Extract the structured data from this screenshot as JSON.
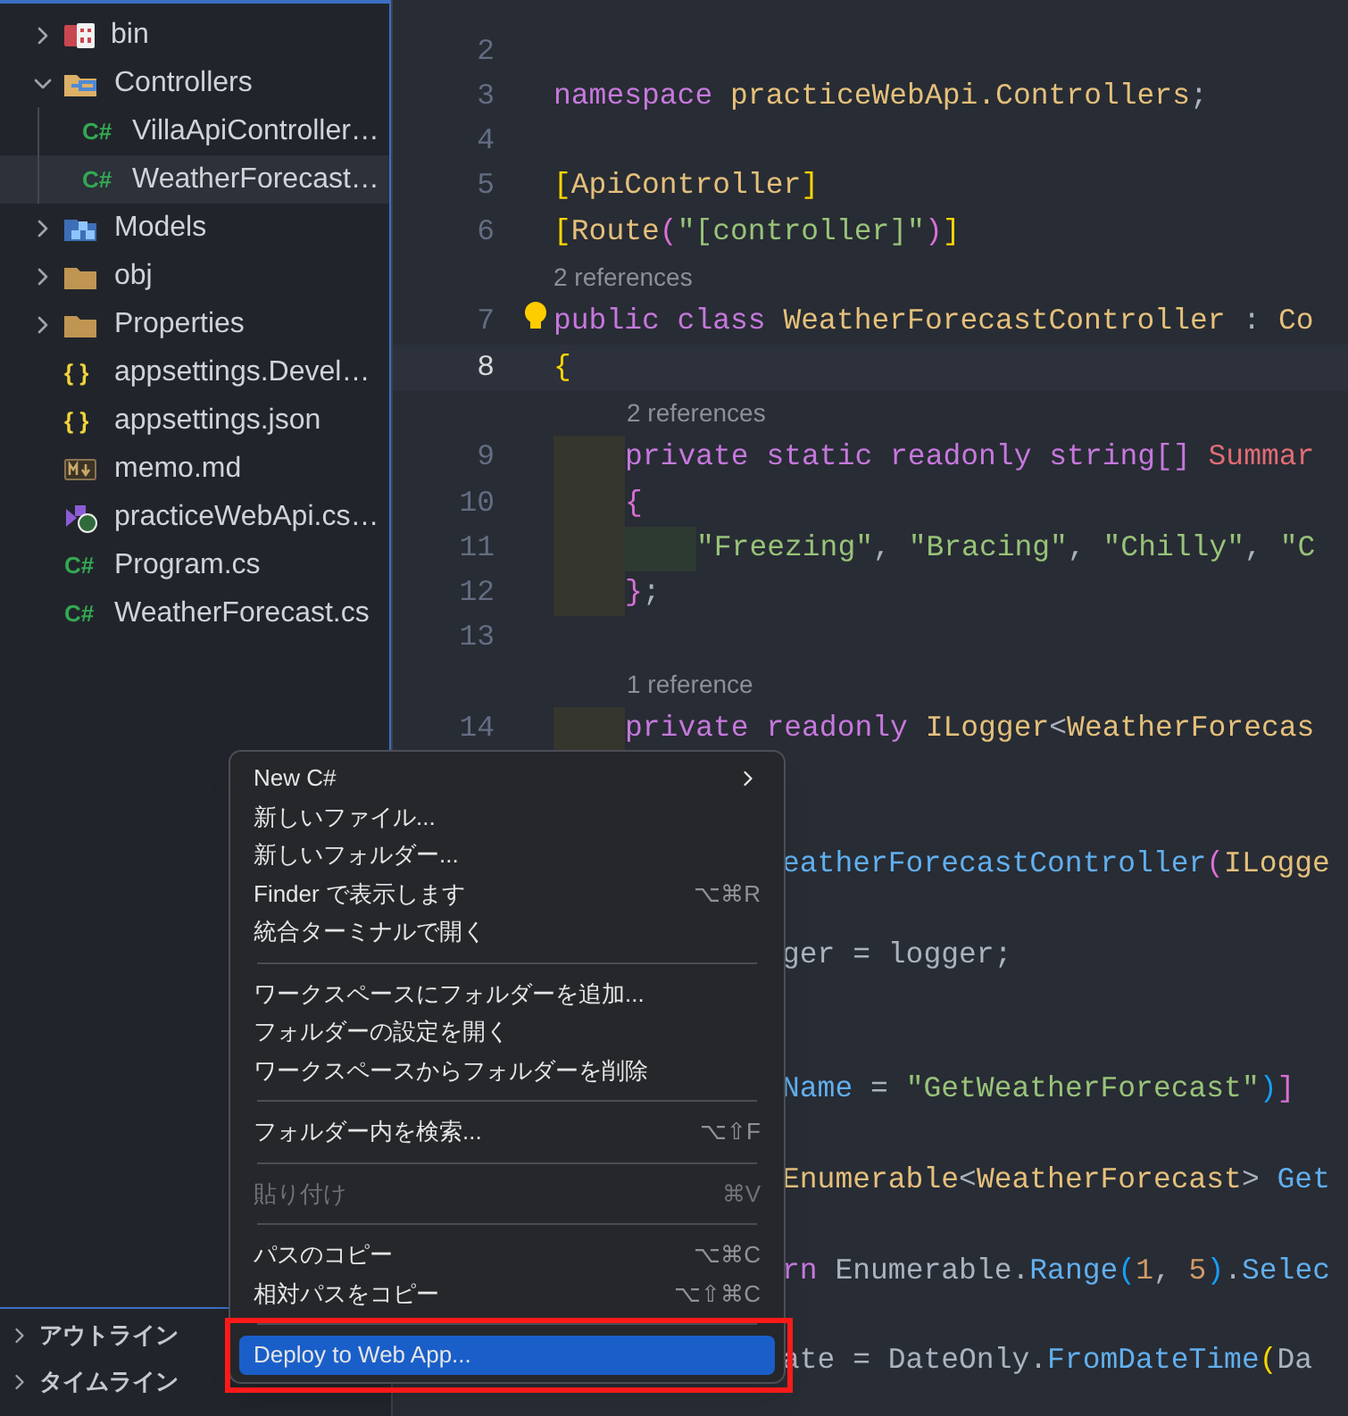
{
  "explorer": {
    "items": [
      {
        "name": "bin",
        "kind": "folder-bin",
        "expanded": false,
        "selected": false
      },
      {
        "name": "Controllers",
        "kind": "folder-controllers",
        "expanded": true,
        "selected": false,
        "children": [
          {
            "name": "VillaApiController…",
            "kind": "csharp",
            "icon_label": "C#",
            "selected": false
          },
          {
            "name": "WeatherForecast…",
            "kind": "csharp",
            "icon_label": "C#",
            "selected": true
          }
        ]
      },
      {
        "name": "Models",
        "kind": "folder-models",
        "expanded": false,
        "selected": false
      },
      {
        "name": "obj",
        "kind": "folder",
        "expanded": false,
        "selected": false
      },
      {
        "name": "Properties",
        "kind": "folder",
        "expanded": false,
        "selected": false
      },
      {
        "name": "appsettings.Devel…",
        "kind": "json",
        "icon_label": "{ }",
        "selected": false
      },
      {
        "name": "appsettings.json",
        "kind": "json",
        "icon_label": "{ }",
        "selected": false
      },
      {
        "name": "memo.md",
        "kind": "markdown",
        "selected": false
      },
      {
        "name": "practiceWebApi.cs…",
        "kind": "csproj",
        "selected": false
      },
      {
        "name": "Program.cs",
        "kind": "csharp",
        "icon_label": "C#",
        "selected": false
      },
      {
        "name": "WeatherForecast.cs",
        "kind": "csharp",
        "icon_label": "C#",
        "selected": false
      }
    ]
  },
  "panels": [
    {
      "title": "アウトライン",
      "expanded": false
    },
    {
      "title": "タイムライン",
      "expanded": false
    }
  ],
  "editor": {
    "rows": [
      {
        "kind": "covered"
      },
      {
        "kind": "code",
        "number": "2",
        "current": false
      },
      {
        "kind": "code",
        "number": "3",
        "current": false,
        "tokens": [
          {
            "kind": "kw",
            "text": "namespace "
          },
          {
            "kind": "type",
            "text": "practiceWebApi.Controllers"
          },
          {
            "kind": "plain",
            "text": ";"
          }
        ]
      },
      {
        "kind": "code",
        "number": "4",
        "current": false
      },
      {
        "kind": "code",
        "number": "5",
        "current": false,
        "tokens": [
          {
            "kind": "b1",
            "text": "["
          },
          {
            "kind": "type",
            "text": "ApiController"
          },
          {
            "kind": "b1",
            "text": "]"
          }
        ]
      },
      {
        "kind": "code",
        "number": "6",
        "current": false,
        "tokens": [
          {
            "kind": "b1",
            "text": "["
          },
          {
            "kind": "type",
            "text": "Route"
          },
          {
            "kind": "b2",
            "text": "("
          },
          {
            "kind": "str",
            "text": "\"[controller]\""
          },
          {
            "kind": "b2",
            "text": ")"
          },
          {
            "kind": "b1",
            "text": "]"
          }
        ]
      },
      {
        "kind": "lens",
        "text": "2 references"
      },
      {
        "kind": "code",
        "number": "7",
        "current": false,
        "lightbulb": true,
        "tokens": [
          {
            "kind": "kw",
            "text": "public class "
          },
          {
            "kind": "type",
            "text": "WeatherForecastController"
          },
          {
            "kind": "plain",
            "text": " : "
          },
          {
            "kind": "type",
            "text": "Co"
          }
        ]
      },
      {
        "kind": "code",
        "number": "8",
        "current": true,
        "tokens": [
          {
            "kind": "b1",
            "text": "{"
          }
        ]
      },
      {
        "kind": "nested_lens",
        "text": "2 references"
      },
      {
        "kind": "code",
        "number": "9",
        "current": false,
        "tokens": [
          {
            "kind": "indent1"
          },
          {
            "kind": "kw",
            "text": "private static readonly string[] "
          },
          {
            "kind": "field",
            "text": "Summar"
          }
        ]
      },
      {
        "kind": "code",
        "number": "10",
        "current": false,
        "tokens": [
          {
            "kind": "indent1"
          },
          {
            "kind": "b2",
            "text": "{"
          }
        ]
      },
      {
        "kind": "code",
        "number": "11",
        "current": false,
        "tokens": [
          {
            "kind": "indent1"
          },
          {
            "kind": "indent2"
          },
          {
            "kind": "str",
            "text": "\"Freezing\""
          },
          {
            "kind": "plain",
            "text": ", "
          },
          {
            "kind": "str",
            "text": "\"Bracing\""
          },
          {
            "kind": "plain",
            "text": ", "
          },
          {
            "kind": "str",
            "text": "\"Chilly\""
          },
          {
            "kind": "plain",
            "text": ", "
          },
          {
            "kind": "str",
            "text": "\"C"
          }
        ]
      },
      {
        "kind": "code",
        "number": "12",
        "current": false,
        "tokens": [
          {
            "kind": "indent1"
          },
          {
            "kind": "b2",
            "text": "}"
          },
          {
            "kind": "plain",
            "text": ";"
          }
        ]
      },
      {
        "kind": "code",
        "number": "13",
        "current": false
      },
      {
        "kind": "nested_lens",
        "text": "1 reference"
      },
      {
        "kind": "code",
        "number": "14",
        "current": false,
        "tokens": [
          {
            "kind": "indent1"
          },
          {
            "kind": "kw",
            "text": "private readonly "
          },
          {
            "kind": "type",
            "text": "ILogger"
          },
          {
            "kind": "plain",
            "text": "<"
          },
          {
            "kind": "type",
            "text": "WeatherForecas"
          }
        ]
      },
      {
        "kind": "covered"
      },
      {
        "kind": "covered"
      },
      {
        "kind": "partial",
        "tokens": [
          {
            "kind": "fn",
            "text": "eatherForecastController"
          },
          {
            "kind": "b2",
            "text": "("
          },
          {
            "kind": "type",
            "text": "ILogge"
          }
        ]
      },
      {
        "kind": "covered"
      },
      {
        "kind": "partial",
        "tokens": [
          {
            "kind": "plain",
            "text": "ger = logger;"
          }
        ]
      },
      {
        "kind": "covered"
      },
      {
        "kind": "covered"
      },
      {
        "kind": "partial",
        "tokens": [
          {
            "kind": "fn",
            "text": "Name"
          },
          {
            "kind": "plain",
            "text": " = "
          },
          {
            "kind": "str",
            "text": "\"GetWeatherForecast\""
          },
          {
            "kind": "b3",
            "text": ")"
          },
          {
            "kind": "b2",
            "text": "]"
          }
        ]
      },
      {
        "kind": "covered"
      },
      {
        "kind": "partial",
        "tokens": [
          {
            "kind": "type",
            "text": "Enumerable"
          },
          {
            "kind": "plain",
            "text": "<"
          },
          {
            "kind": "type",
            "text": "WeatherForecast"
          },
          {
            "kind": "plain",
            "text": "> "
          },
          {
            "kind": "fn",
            "text": "Get"
          }
        ]
      },
      {
        "kind": "covered"
      },
      {
        "kind": "partial",
        "tokens": [
          {
            "kind": "kw",
            "text": "rn "
          },
          {
            "kind": "plain",
            "text": "Enumerable."
          },
          {
            "kind": "fn",
            "text": "Range"
          },
          {
            "kind": "b3",
            "text": "("
          },
          {
            "kind": "num",
            "text": "1"
          },
          {
            "kind": "plain",
            "text": ", "
          },
          {
            "kind": "num",
            "text": "5"
          },
          {
            "kind": "b3",
            "text": ")"
          },
          {
            "kind": "plain",
            "text": "."
          },
          {
            "kind": "fn",
            "text": "Selec"
          }
        ]
      },
      {
        "kind": "covered"
      },
      {
        "kind": "partial",
        "tokens": [
          {
            "kind": "plain",
            "text": "ate = DateOnly."
          },
          {
            "kind": "fn",
            "text": "FromDateTime"
          },
          {
            "kind": "b1",
            "text": "("
          },
          {
            "kind": "plain",
            "text": "Da"
          }
        ]
      }
    ]
  },
  "context_menu": {
    "items": [
      {
        "kind": "item",
        "label": "New C#",
        "submenu": true,
        "disabled": false,
        "selected": false
      },
      {
        "kind": "item",
        "label": "新しいファイル...",
        "disabled": false,
        "selected": false
      },
      {
        "kind": "item",
        "label": "新しいフォルダー...",
        "disabled": false,
        "selected": false
      },
      {
        "kind": "item",
        "label": "Finder で表示します",
        "shortcut": "⌥⌘R",
        "disabled": false,
        "selected": false
      },
      {
        "kind": "item",
        "label": "統合ターミナルで開く",
        "disabled": false,
        "selected": false
      },
      {
        "kind": "separator"
      },
      {
        "kind": "item",
        "label": "ワークスペースにフォルダーを追加...",
        "disabled": false,
        "selected": false
      },
      {
        "kind": "item",
        "label": "フォルダーの設定を開く",
        "disabled": false,
        "selected": false
      },
      {
        "kind": "item",
        "label": "ワークスペースからフォルダーを削除",
        "disabled": false,
        "selected": false
      },
      {
        "kind": "separator"
      },
      {
        "kind": "item",
        "label": "フォルダー内を検索...",
        "shortcut": "⌥⇧F",
        "disabled": false,
        "selected": false
      },
      {
        "kind": "separator"
      },
      {
        "kind": "item",
        "label": "貼り付け",
        "shortcut": "⌘V",
        "disabled": true,
        "selected": false
      },
      {
        "kind": "separator"
      },
      {
        "kind": "item",
        "label": "パスのコピー",
        "shortcut": "⌥⌘C",
        "disabled": false,
        "selected": false
      },
      {
        "kind": "item",
        "label": "相対パスをコピー",
        "shortcut": "⌥⇧⌘C",
        "disabled": false,
        "selected": false
      },
      {
        "kind": "separator"
      },
      {
        "kind": "item",
        "label": "Deploy to Web App...",
        "disabled": false,
        "selected": true,
        "highlighted": true
      }
    ]
  }
}
